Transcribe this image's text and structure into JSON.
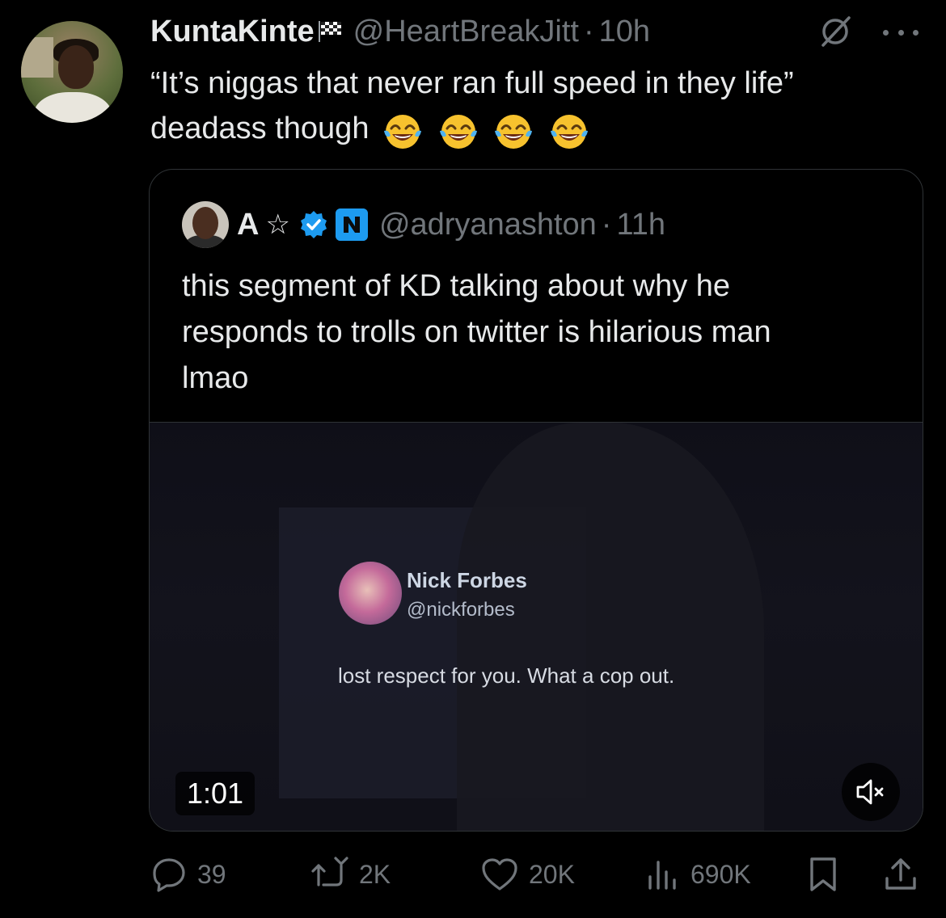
{
  "tweet": {
    "author_name": "KuntaKinte",
    "author_handle": "@HeartBreakJitt",
    "separator": "·",
    "time": "10h",
    "text_line1": "“It’s niggas that never ran full speed in they life”",
    "text_line2": "deadass though",
    "emojis": [
      "face-with-tears-of-joy",
      "face-with-tears-of-joy",
      "face-with-tears-of-joy",
      "face-with-tears-of-joy"
    ]
  },
  "quote": {
    "author_name": "A",
    "star": "☆",
    "author_handle": "@adryanashton",
    "separator": "·",
    "time": "11h",
    "text_line1": "this segment of KD talking about why he",
    "text_line2": "responds to trolls on twitter is hilarious man",
    "text_line3": "lmao",
    "video": {
      "overlay_name": "Nick Forbes",
      "overlay_handle": "@nickforbes",
      "overlay_text": "lost respect for you. What a cop out.",
      "duration": "1:01"
    }
  },
  "actions": {
    "replies": "39",
    "reposts": "2K",
    "likes": "20K",
    "views": "690K"
  },
  "colors": {
    "background": "#000000",
    "text": "#e7e9ea",
    "muted": "#71767b",
    "border": "#2f3336",
    "verified": "#1d9bf0"
  }
}
